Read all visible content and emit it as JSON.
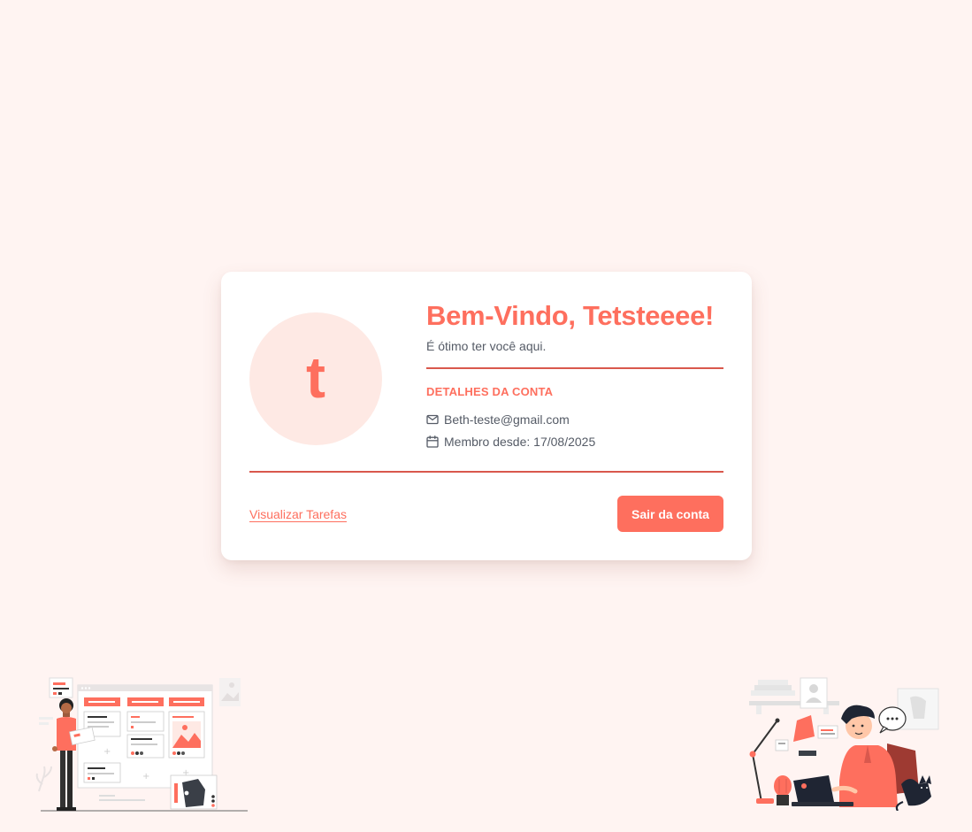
{
  "profile": {
    "avatar_letter": "t",
    "welcome": "Bem-Vindo, Tetsteeee!",
    "subtitle": "É ótimo ter você aqui.",
    "details_title": "DETALHES DA CONTA",
    "email": "Beth-teste@gmail.com",
    "member_since": "Membro desde: 17/08/2025"
  },
  "actions": {
    "view_tasks": "Visualizar Tarefas",
    "logout": "Sair da conta"
  },
  "icons": {
    "email": "mail-icon",
    "member_since": "calendar-icon"
  },
  "colors": {
    "accent": "#fe6f5e",
    "divider": "#d9584d",
    "page_background": "#fff4f2",
    "avatar_background": "#fee9e4",
    "text_muted": "#555b66"
  }
}
